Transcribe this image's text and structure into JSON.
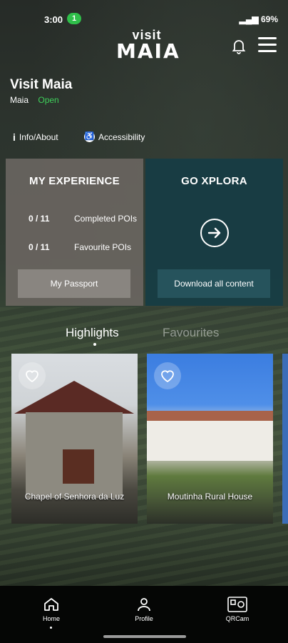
{
  "status_bar": {
    "time": "3:00",
    "notification_count": "1",
    "battery": "69%"
  },
  "logo": {
    "line1": "visit",
    "line2": "MAIA"
  },
  "header": {
    "title": "Visit Maia",
    "location": "Maia",
    "status": "Open"
  },
  "links": {
    "info": "Info/About",
    "accessibility": "Accessibility"
  },
  "my_experience": {
    "title": "MY EXPERIENCE",
    "completed_count": "0 / 11",
    "completed_label": "Completed POIs",
    "favourite_count": "0 / 11",
    "favourite_label": "Favourite POIs",
    "button": "My Passport"
  },
  "go_xplora": {
    "title": "GO XPLORA",
    "button": "Download all content"
  },
  "tabs": [
    {
      "label": "Highlights",
      "active": true
    },
    {
      "label": "Favourites",
      "active": false
    }
  ],
  "highlights": [
    {
      "name": "Chapel of Senhora da Luz"
    },
    {
      "name": "Moutinha Rural House"
    }
  ],
  "bottom_nav": [
    {
      "label": "Home",
      "icon": "home-icon",
      "active": true
    },
    {
      "label": "Profile",
      "icon": "user-icon",
      "active": false
    },
    {
      "label": "QRCam",
      "icon": "qr-camera-icon",
      "active": false
    }
  ],
  "colors": {
    "open_status": "#3ecf5a",
    "experience_card": "#6e6964",
    "xplora_card": "#143c46",
    "notification_pill": "#2fbf4a"
  }
}
